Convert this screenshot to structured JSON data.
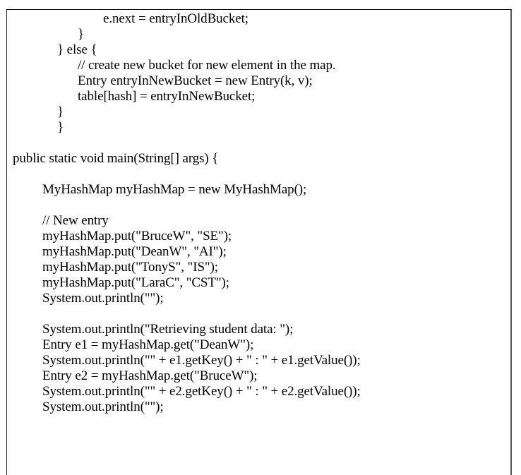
{
  "document": {
    "type": "java-code-listing",
    "lines": [
      {
        "text": "e.next = entryInOldBucket;",
        "indent": 5,
        "row": 0
      },
      {
        "text": "}",
        "indent": 4,
        "row": 1
      },
      {
        "text": "} else {",
        "indent": 3,
        "row": 2
      },
      {
        "text": "// create new bucket for new element in the map.",
        "indent": 4,
        "row": 3
      },
      {
        "text": "Entry entryInNewBucket = new Entry(k, v);",
        "indent": 4,
        "row": 4
      },
      {
        "text": "table[hash] = entryInNewBucket;",
        "indent": 4,
        "row": 5
      },
      {
        "text": "}",
        "indent": 3,
        "row": 6
      },
      {
        "text": "}",
        "indent": 2,
        "row": 7
      },
      {
        "text": "public static void main(String[] args) {",
        "indent": 0,
        "row": 9
      },
      {
        "text": "MyHashMap myHashMap = new MyHashMap();",
        "indent": 1,
        "row": 11
      },
      {
        "text": "// New entry",
        "indent": 1,
        "row": 13
      },
      {
        "text": "myHashMap.put(\"BruceW\", \"SE\");",
        "indent": 1,
        "row": 14
      },
      {
        "text": "myHashMap.put(\"DeanW\", \"AI\");",
        "indent": 1,
        "row": 15
      },
      {
        "text": "myHashMap.put(\"TonyS\", \"IS\");",
        "indent": 1,
        "row": 16
      },
      {
        "text": "myHashMap.put(\"LaraC\", \"CST\");",
        "indent": 1,
        "row": 17
      },
      {
        "text": "System.out.println(\"\");",
        "indent": 1,
        "row": 18
      },
      {
        "text": "System.out.println(\"Retrieving student data: \");",
        "indent": 1,
        "row": 20
      },
      {
        "text": "Entry e1 = myHashMap.get(\"DeanW\");",
        "indent": 1,
        "row": 21
      },
      {
        "text": "System.out.println(\"\" + e1.getKey() + \" : \" + e1.getValue());",
        "indent": 1,
        "row": 22
      },
      {
        "text": "Entry e2 = myHashMap.get(\"BruceW\");",
        "indent": 1,
        "row": 23
      },
      {
        "text": "System.out.println(\"\" + e2.getKey() + \" : \" + e2.getValue());",
        "indent": 1,
        "row": 24
      },
      {
        "text": "System.out.println(\"\");",
        "indent": 1,
        "row": 25
      }
    ]
  }
}
